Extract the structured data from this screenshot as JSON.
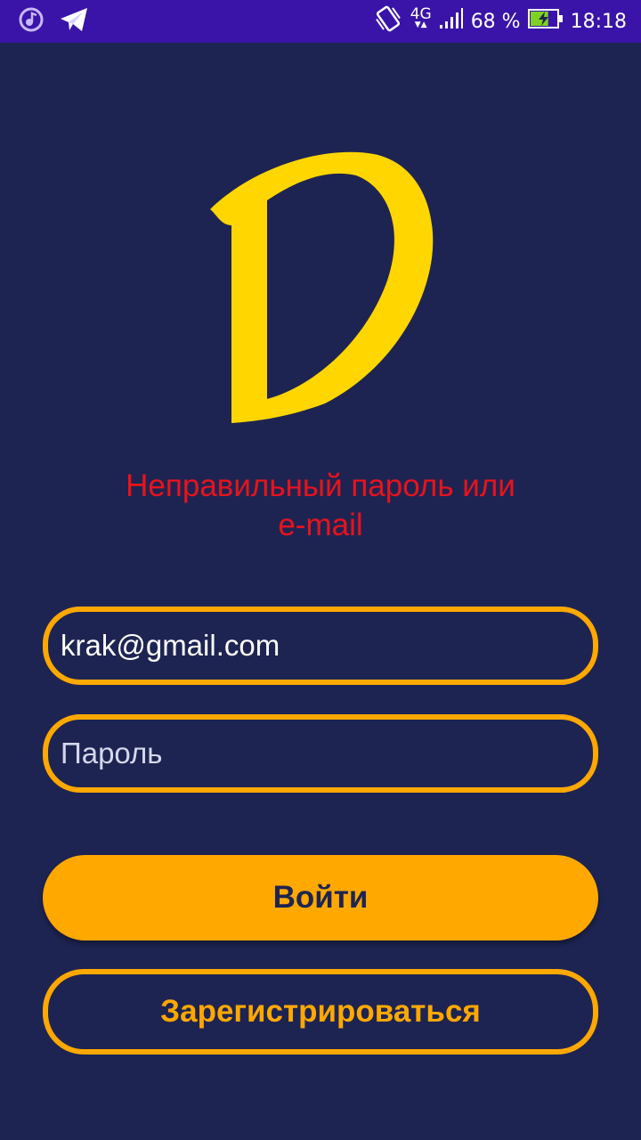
{
  "status_bar": {
    "icons_left": [
      "music-icon",
      "telegram-icon"
    ],
    "network": "4G",
    "battery_percent": "68 %",
    "battery_level": 0.68,
    "time": "18:18"
  },
  "login": {
    "error_line1": "Неправильный пароль или",
    "error_line2": "e-mail",
    "email_value": "krak@gmail.com",
    "password_placeholder": "Пароль",
    "login_button": "Войти",
    "register_button": "Зарегистрироваться"
  },
  "colors": {
    "background": "#1e2452",
    "status_bar": "#3a14a8",
    "accent": "#ffa800",
    "logo": "#ffd600",
    "error": "#e8131c"
  }
}
